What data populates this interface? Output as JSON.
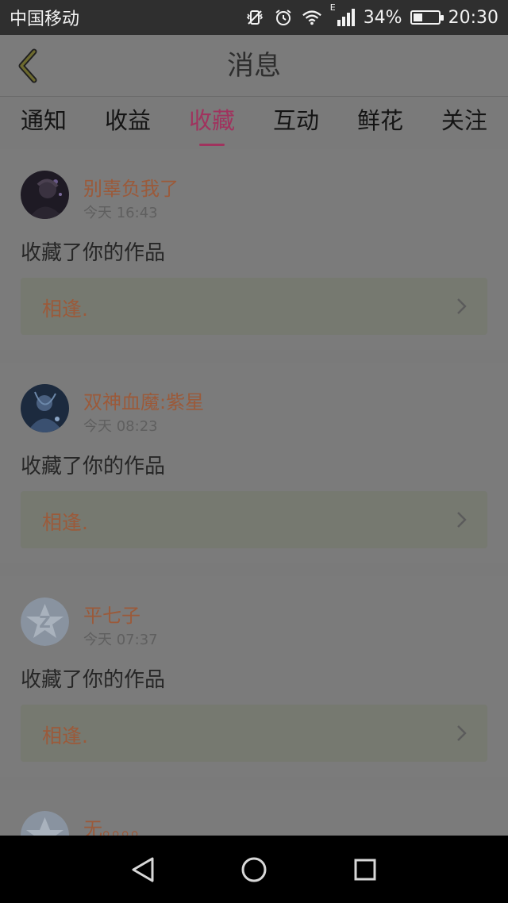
{
  "status_bar": {
    "carrier": "中国移动",
    "network_type": "E",
    "battery_percent": "34%",
    "battery_level": 0.34,
    "time": "20:30",
    "icons": [
      "vibrate-icon",
      "alarm-icon",
      "wifi-icon",
      "signal-icon",
      "battery-icon"
    ]
  },
  "header": {
    "title": "消息",
    "back_icon": "chevron-left-icon"
  },
  "tabs": [
    {
      "label": "通知",
      "active": false
    },
    {
      "label": "收益",
      "active": false
    },
    {
      "label": "收藏",
      "active": true
    },
    {
      "label": "互动",
      "active": false
    },
    {
      "label": "鲜花",
      "active": false
    },
    {
      "label": "关注",
      "active": false
    }
  ],
  "messages": [
    {
      "username": "别辜负我了",
      "time": "今天 16:43",
      "action": "收藏了你的作品",
      "work_title": "相逢.",
      "avatar": "avatar-dark-portrait"
    },
    {
      "username": "双神血魔:紫星",
      "time": "今天 08:23",
      "action": "收藏了你的作品",
      "work_title": "相逢.",
      "avatar": "avatar-blue-figure"
    },
    {
      "username": "平七子",
      "time": "今天 07:37",
      "action": "收藏了你的作品",
      "work_title": "相逢.",
      "avatar": "avatar-default-star"
    },
    {
      "username": "无。。。。",
      "avatar": "avatar-default-star"
    }
  ],
  "colors": {
    "accent": "#a0335e",
    "username": "#9b5a3a",
    "dim_overlay": "#7b7b7b"
  },
  "nav_bar": {
    "icons": [
      "back-triangle-icon",
      "home-circle-icon",
      "recents-square-icon"
    ]
  }
}
